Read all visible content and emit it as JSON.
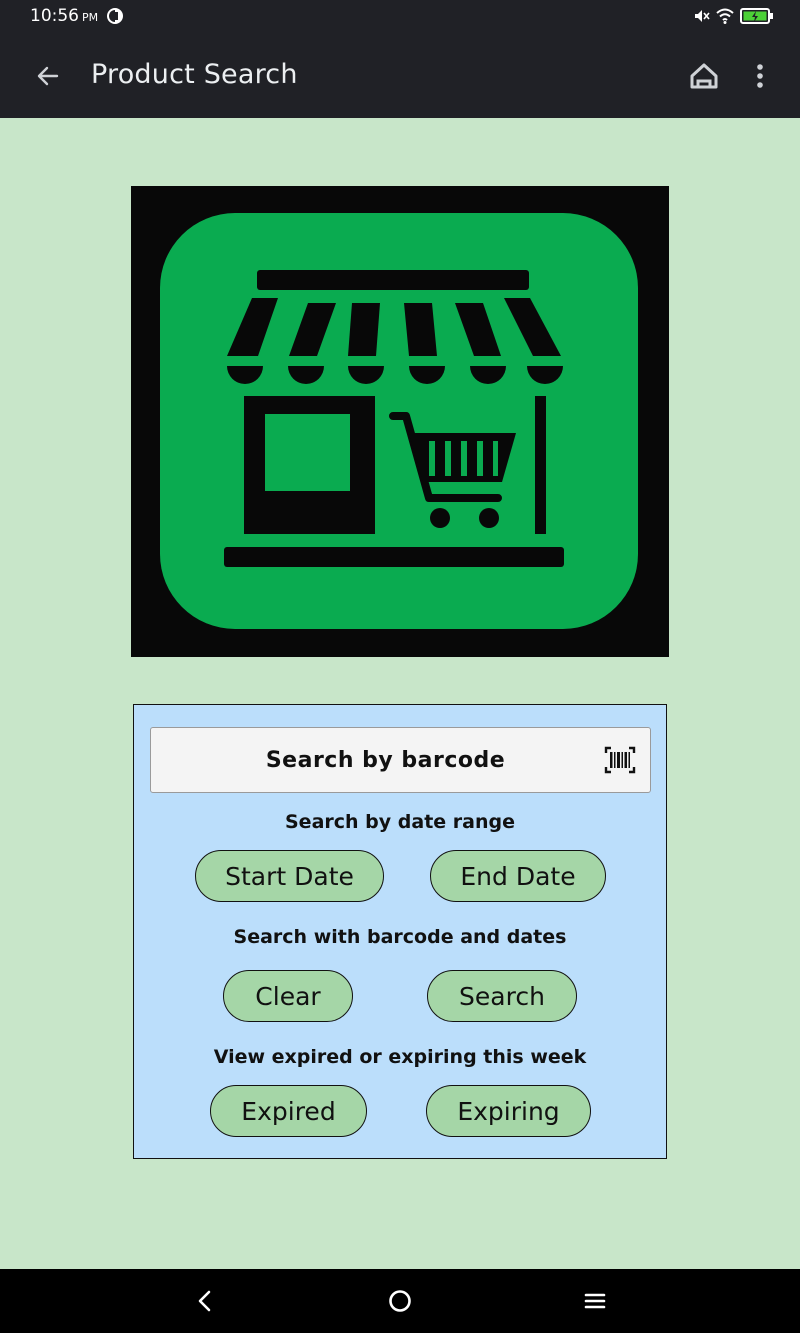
{
  "status_bar": {
    "time": "10:56",
    "ampm": "PM"
  },
  "app_bar": {
    "title": "Product Search"
  },
  "search": {
    "barcode_placeholder": "Search by barcode",
    "date_range_label": "Search by date range",
    "start_date_label": "Start Date",
    "end_date_label": "End Date",
    "combined_label": "Search with barcode and dates",
    "clear_label": "Clear",
    "search_label": "Search",
    "expiry_label": "View expired or expiring this week",
    "expired_label": "Expired",
    "expiring_label": "Expiring"
  },
  "colors": {
    "background": "#c8e6c9",
    "panel": "#bbdefb",
    "button": "#a5d6a7",
    "logo_green": "#0aab50",
    "app_bar": "#202126"
  },
  "icons": {
    "back": "arrow-left-icon",
    "home": "home-icon",
    "more": "more-vert-icon",
    "scan": "barcode-scan-icon",
    "logo": "storefront-cart-icon"
  }
}
